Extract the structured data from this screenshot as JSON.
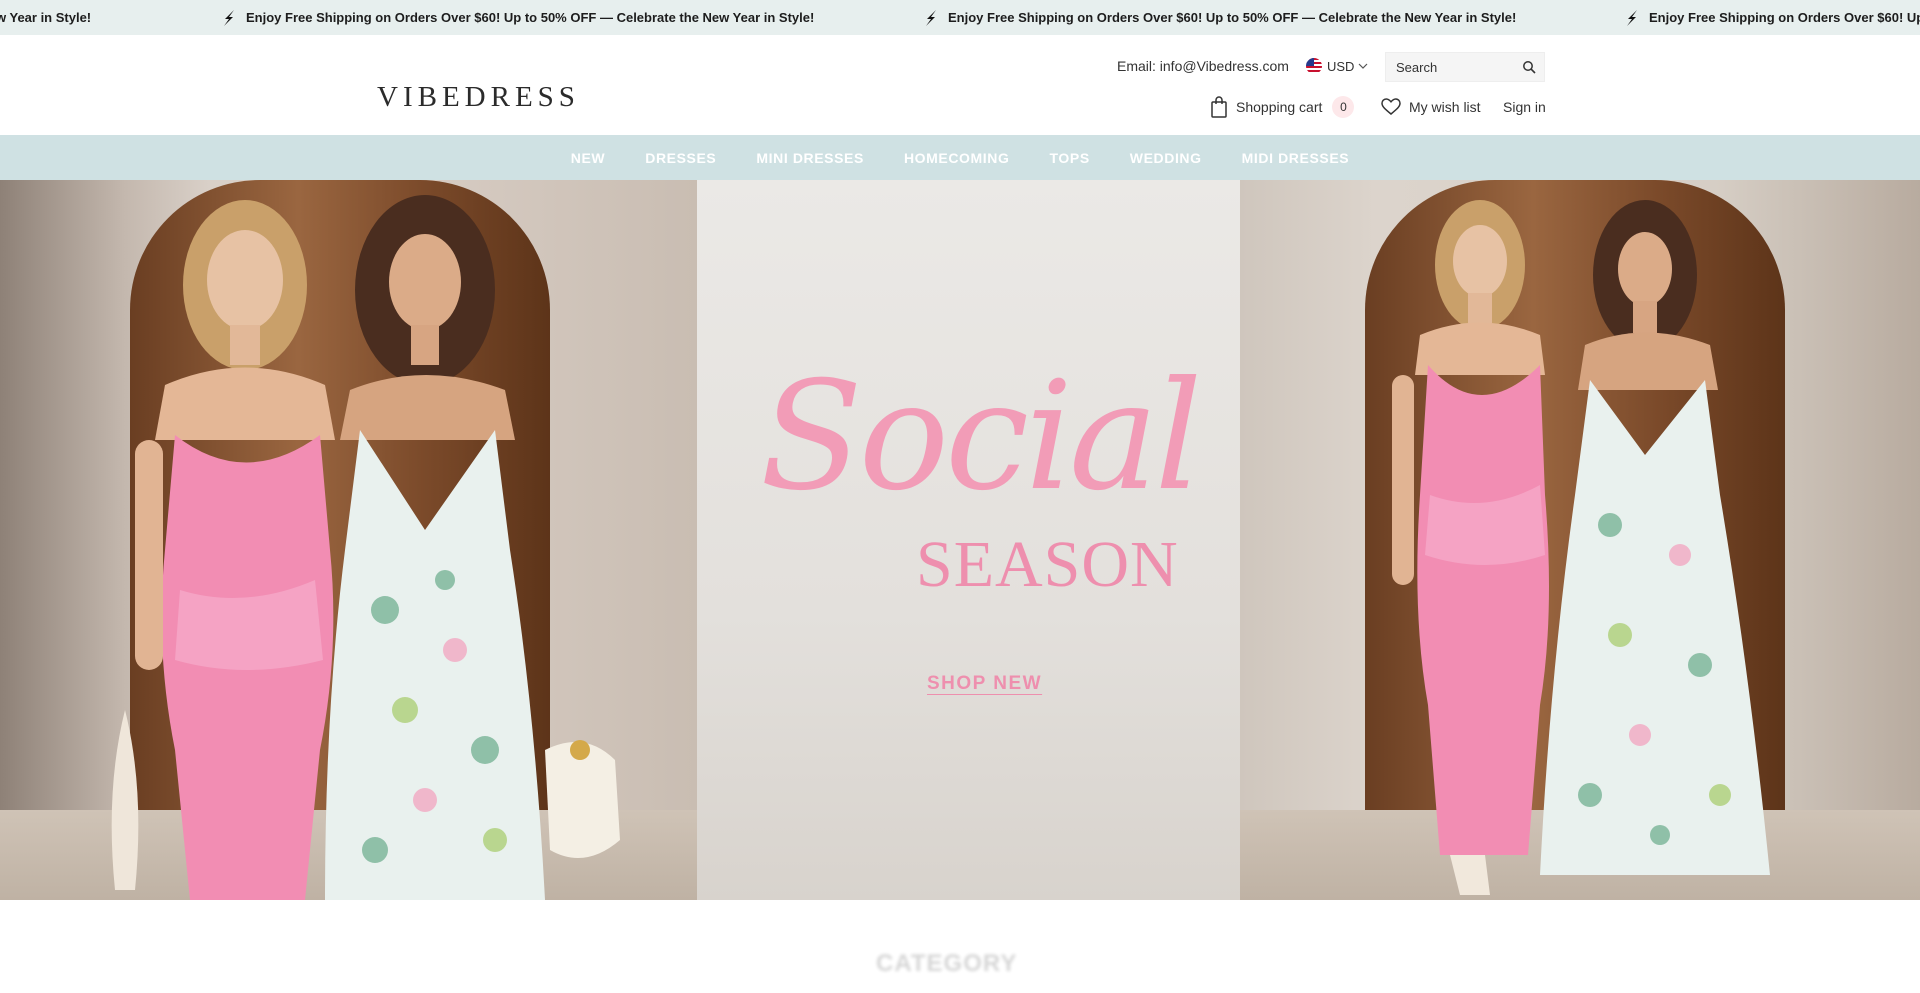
{
  "announcement": {
    "text": "Enjoy Free Shipping on Orders Over $60! Up to 50% OFF — Celebrate the New Year in Style!",
    "partial_text": "w Year in Style!",
    "icon": "lightning-bolt-icon"
  },
  "header": {
    "logo": "VIBEDRESS",
    "email_label": "Email: info@Vibedress.com",
    "currency": "USD",
    "search_placeholder": "Search",
    "cart_label": "Shopping cart",
    "cart_count": "0",
    "wishlist_label": "My wish list",
    "signin_label": "Sign in"
  },
  "nav": {
    "items": [
      "NEW",
      "DRESSES",
      "MINI DRESSES",
      "HOMECOMING",
      "TOPS",
      "WEDDING",
      "MIDI DRESSES"
    ]
  },
  "hero": {
    "script_text": "Social",
    "season_text": "SEASON",
    "cta_label": "SHOP NEW"
  },
  "below": {
    "partial_title": "CATEGORY"
  },
  "colors": {
    "announcement_bg": "#e7efee",
    "nav_bg": "#cfe1e3",
    "hero_pink": "#f29cb7",
    "cart_badge_bg": "#fde8ea"
  }
}
